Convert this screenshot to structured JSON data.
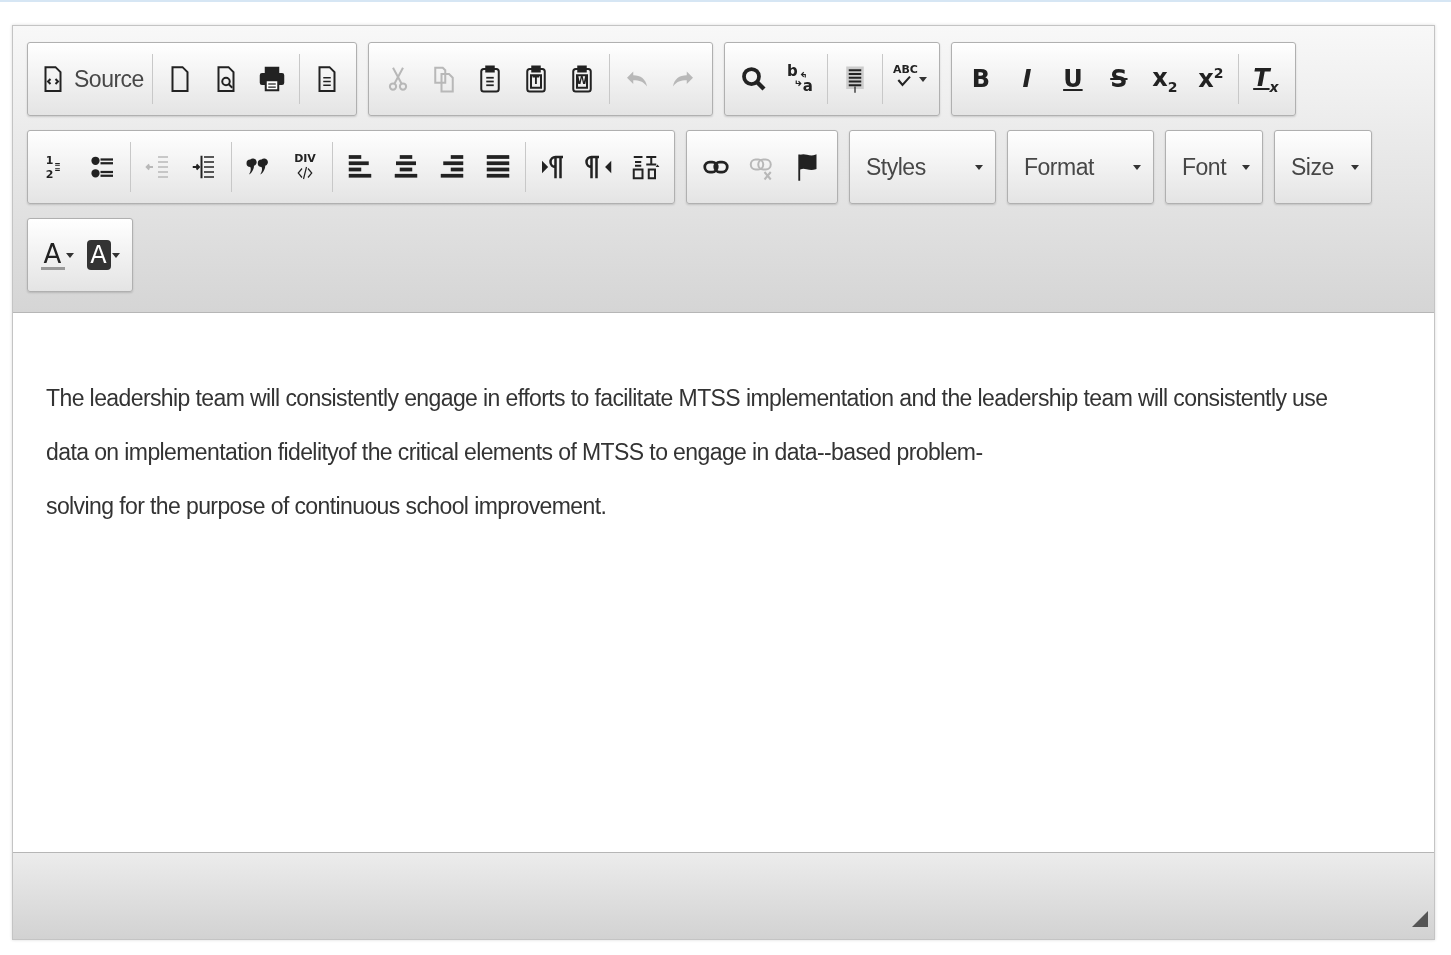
{
  "toolbar": {
    "rows": [
      [
        {
          "items": [
            {
              "kind": "source",
              "label": "Source",
              "disabled": false
            },
            {
              "kind": "separator"
            },
            {
              "kind": "new-page",
              "disabled": false
            },
            {
              "kind": "preview",
              "disabled": false
            },
            {
              "kind": "print",
              "disabled": false
            },
            {
              "kind": "separator"
            },
            {
              "kind": "templates",
              "disabled": false
            }
          ]
        },
        {
          "items": [
            {
              "kind": "cut",
              "disabled": true
            },
            {
              "kind": "copy",
              "disabled": true
            },
            {
              "kind": "paste",
              "disabled": false
            },
            {
              "kind": "paste-text",
              "glyphs": [
                "T"
              ],
              "disabled": false
            },
            {
              "kind": "paste-word",
              "glyphs": [
                "W"
              ],
              "disabled": false
            },
            {
              "kind": "separator"
            },
            {
              "kind": "undo",
              "disabled": true
            },
            {
              "kind": "redo",
              "disabled": true
            }
          ]
        },
        {
          "items": [
            {
              "kind": "find",
              "disabled": false
            },
            {
              "kind": "replace",
              "glyphs": [
                "b",
                "a"
              ],
              "disabled": false
            },
            {
              "kind": "separator"
            },
            {
              "kind": "select-all",
              "disabled": false
            },
            {
              "kind": "separator"
            },
            {
              "kind": "spellcheck",
              "glyphs": [
                "ABC"
              ],
              "disabled": false
            }
          ]
        },
        {
          "items": [
            {
              "kind": "bold",
              "label": "B",
              "disabled": false
            },
            {
              "kind": "italic",
              "label": "I",
              "disabled": false
            },
            {
              "kind": "underline",
              "label": "U",
              "disabled": false
            },
            {
              "kind": "strike",
              "label": "S",
              "disabled": false
            },
            {
              "kind": "subscript",
              "label": "x$_{2}$",
              "disabled": false
            },
            {
              "kind": "superscript",
              "label": "x$^{2}$",
              "disabled": false
            },
            {
              "kind": "separator"
            },
            {
              "kind": "remove-format",
              "label": "T$_{x}$",
              "disabled": false
            }
          ]
        }
      ],
      [
        {
          "items": [
            {
              "kind": "numbered-list",
              "glyphs": [
                "1",
                "2"
              ],
              "disabled": false
            },
            {
              "kind": "bulleted-list",
              "disabled": false
            },
            {
              "kind": "separator"
            },
            {
              "kind": "outdent",
              "disabled": true
            },
            {
              "kind": "indent",
              "disabled": false
            },
            {
              "kind": "separator"
            },
            {
              "kind": "blockquote",
              "disabled": false
            },
            {
              "kind": "div",
              "glyphs": [
                "DIV"
              ],
              "disabled": false
            },
            {
              "kind": "separator"
            },
            {
              "kind": "align-left",
              "disabled": false
            },
            {
              "kind": "align-center",
              "disabled": false
            },
            {
              "kind": "align-right",
              "disabled": false
            },
            {
              "kind": "justify",
              "disabled": false
            },
            {
              "kind": "separator"
            },
            {
              "kind": "ltr",
              "disabled": false
            },
            {
              "kind": "rtl",
              "disabled": false
            },
            {
              "kind": "language",
              "disabled": false
            }
          ]
        },
        {
          "items": [
            {
              "kind": "link",
              "disabled": false
            },
            {
              "kind": "unlink",
              "disabled": true
            },
            {
              "kind": "anchor",
              "disabled": false
            }
          ]
        },
        {
          "kind": "combo",
          "label": "Styles"
        },
        {
          "kind": "combo",
          "label": "Format"
        },
        {
          "kind": "combo",
          "label": "Font"
        },
        {
          "kind": "combo",
          "label": "Size"
        }
      ],
      [
        {
          "items": [
            {
              "kind": "text-color",
              "glyphs": [
                "A"
              ],
              "disabled": false
            },
            {
              "kind": "bg-color",
              "glyphs": [
                "A"
              ],
              "disabled": false
            }
          ]
        }
      ]
    ]
  },
  "content": {
    "lines": [
      "The leadership team will consistently engage in efforts to facilitate MTSS implementation and the leadership team will consistently use",
      "data on implementation fidelityof the critical elements of MTSS to engage in data--based problem-",
      "solving for the purpose of continuous school improvement."
    ]
  }
}
